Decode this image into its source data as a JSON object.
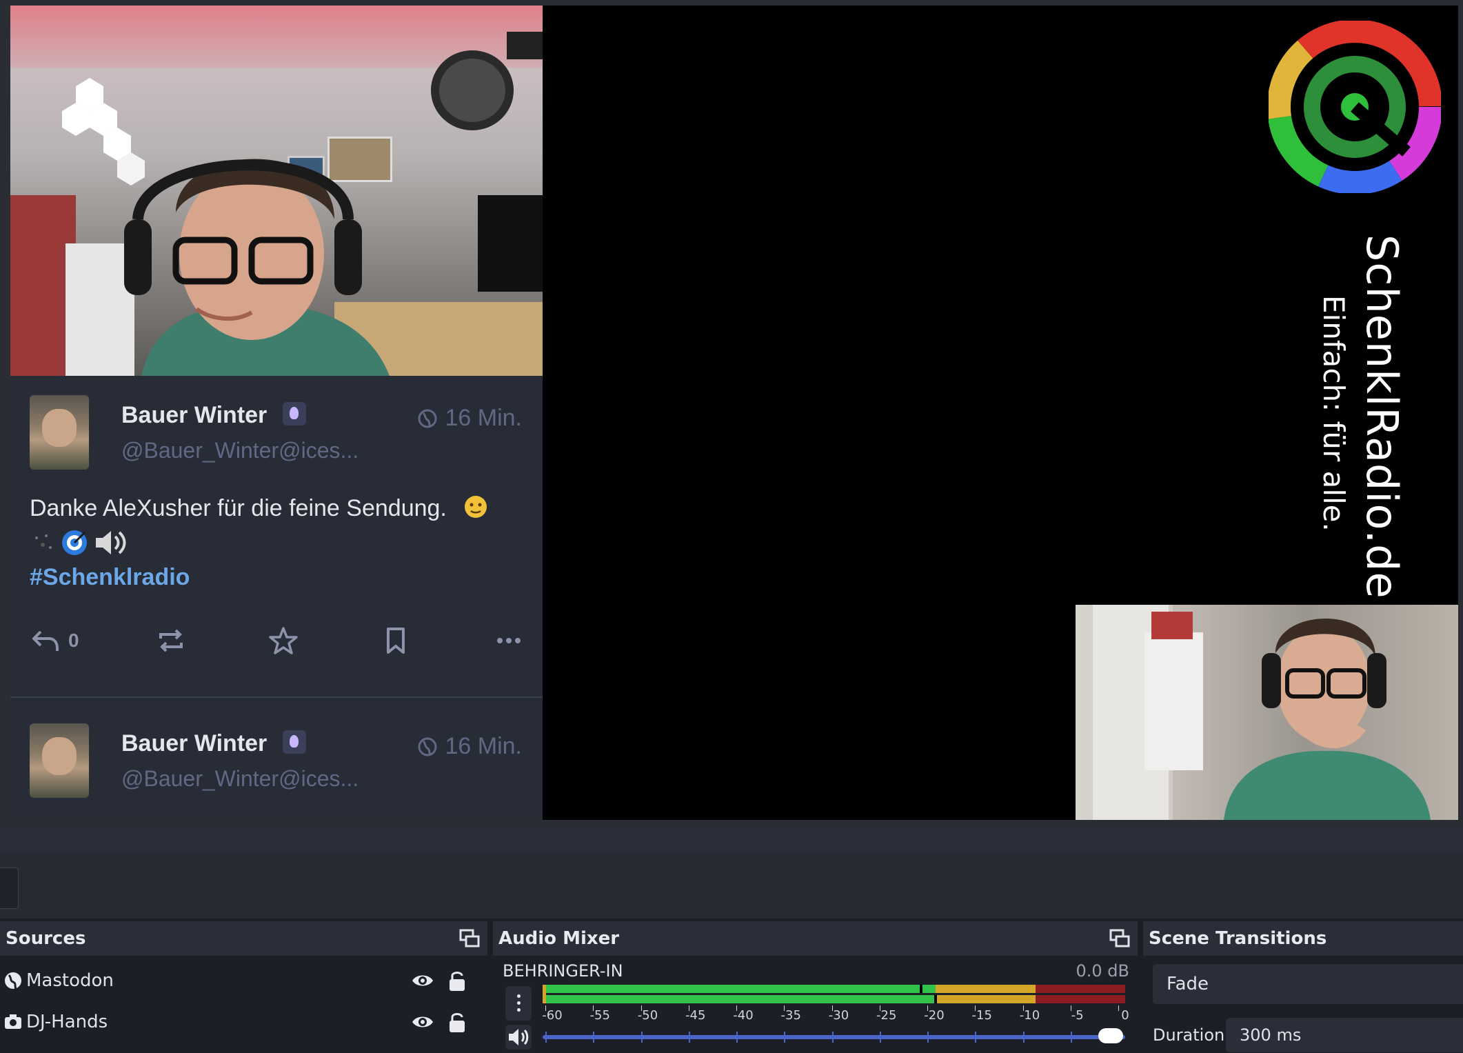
{
  "stream": {
    "brand_title": "SchenklRadio.de",
    "brand_tagline": "Einfach: für alle."
  },
  "mastodon": {
    "toots": [
      {
        "display_name": "Bauer Winter",
        "handle": "@Bauer_Winter@ices...",
        "time": "16 Min.",
        "text": "Danke AleXusher für die feine Sendung.",
        "hashtag": "#Schenklradio",
        "reply_count": "0"
      },
      {
        "display_name": "Bauer Winter",
        "handle": "@Bauer_Winter@ices...",
        "time": "16 Min."
      }
    ],
    "accent_color": "#6ca7e8"
  },
  "docks": {
    "sources": {
      "title": "Sources",
      "items": [
        {
          "label": "Mastodon",
          "icon": "globe-icon"
        },
        {
          "label": "DJ-Hands",
          "icon": "camera-icon"
        }
      ]
    },
    "audio_mixer": {
      "title": "Audio Mixer",
      "channel": "BEHRINGER-IN",
      "level": "0.0 dB",
      "scale": [
        "-60",
        "-55",
        "-50",
        "-45",
        "-40",
        "-35",
        "-30",
        "-25",
        "-20",
        "-15",
        "-10",
        "-5",
        "0"
      ],
      "meter_colors": {
        "green": "#31c24a",
        "yellow": "#d4a627",
        "red": "#8c1d22"
      },
      "volume_fraction": 1.0
    },
    "scene_transitions": {
      "title": "Scene Transitions",
      "selected": "Fade",
      "duration_label": "Duration",
      "duration_value": "300 ms"
    }
  }
}
